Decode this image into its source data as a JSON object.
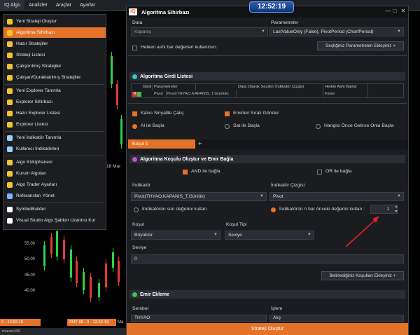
{
  "menubar": {
    "items": [
      "IQ Algo",
      "Analizler",
      "Araçlar",
      "Ayarlar"
    ],
    "clock": "12:52:19"
  },
  "dropdown": {
    "items": [
      {
        "label": "Yeni Strateji Oluştur",
        "icon": "strategy-new-icon",
        "color": "#f2c230"
      },
      {
        "label": "Algoritma Sihirbazı",
        "icon": "wizard-icon",
        "color": "#f2c230",
        "selected": true
      },
      {
        "label": "Hazır Stratejiler",
        "icon": "ready-strategies-icon",
        "color": "#f2c230"
      },
      {
        "label": "Strateji Listesi",
        "icon": "strategy-list-icon",
        "color": "#f2c230"
      },
      {
        "label": "Çalıştırılmış Stratejiler",
        "icon": "running-strategies-icon",
        "color": "#f2c230"
      },
      {
        "label": "Çalışan/Duraklatılmış Stratejiler",
        "icon": "paused-strategies-icon",
        "color": "#f2c230"
      },
      {
        "label": "Yeni Explorer Tanımla",
        "icon": "explorer-new-icon",
        "color": "#f2c230"
      },
      {
        "label": "Explorer Sihirbazı",
        "icon": "explorer-wizard-icon",
        "color": "#f2c230"
      },
      {
        "label": "Hazır Explorer Listesi",
        "icon": "explorer-ready-icon",
        "color": "#f2c230"
      },
      {
        "label": "Explorer Listesi",
        "icon": "explorer-list-icon",
        "color": "#f2c230"
      },
      {
        "label": "Yeni İndikatör Tanımla",
        "icon": "indicator-new-icon",
        "color": "#9bd0ff"
      },
      {
        "label": "Kullanıcı İndikatörleri",
        "icon": "user-indicators-icon",
        "color": "#9bd0ff"
      },
      {
        "label": "Algo Kütüphanesi",
        "icon": "library-icon",
        "color": "#f2c230"
      },
      {
        "label": "Kurum Algoları",
        "icon": "institution-algos-icon",
        "color": "#f2c230"
      },
      {
        "label": "Algo Trader Ayarları",
        "icon": "trader-settings-icon",
        "color": "#f2c230"
      },
      {
        "label": "Referansları Yönet",
        "icon": "references-icon",
        "color": "#7fb2ff"
      },
      {
        "label": "SymbolBuilder",
        "icon": "symbolbuilder-icon",
        "color": "#ffffff"
      },
      {
        "label": "Visual Studio Algo Şablon Uzantısı Kur",
        "icon": "vs-extension-icon",
        "color": "#ffffff"
      }
    ]
  },
  "chart": {
    "prices": [
      "55.00",
      "50.00",
      "45.00",
      "40.00"
    ],
    "date_label": "18 Mar",
    "bottom_left": "0 - 12:52:19",
    "bottom_mid": "2347.88 - 0 - 12:52:19",
    "bottom_mid2": "Ma",
    "footer": "maran430"
  },
  "dialog": {
    "title": "Algoritma Sihirbazı",
    "logo": "IQ",
    "data_label": "Data",
    "data_value": "Kapanış",
    "params_label": "Parametreler",
    "params_value": "LastValueOnly (False), PivotPeriod (ChartPeriod)",
    "heiken_label": "Heiken ashi bar değerleri kullanılsın.",
    "add_params_btn": "Seçtiğiniz Parametreleri Ekleyiniz",
    "input_list_title": "Algoritma Girdi Listesi",
    "table_headers": [
      "Girdi",
      "Parametreler",
      "Data Olarak Seçilen İndikatör Çizgisi",
      "Heikin Ashi Barlar"
    ],
    "table_row": [
      "Pivot",
      "Pivot(THYAO.KAPANIS_T,Günlük)",
      "",
      "False"
    ],
    "persistent_signal": "Kalıcı Sinyallle Çalış",
    "ordered_orders": "Emirleri Sıralı Gönder",
    "buy_start": "Al ile Başla",
    "sell_start": "Sat ile Başla",
    "either_start": "Hangisi Önce Gelirse Onla Başla",
    "tab_label": "Koşul 1",
    "cond_title": "Algoritma Koşulu Oluştur ve Emir Bağla",
    "and_label": "AND ile bağla",
    "or_label": "OR ile bağla",
    "indicator_label": "İndikatör",
    "indicator_value": "Pivot(THYAO.KAPANIS_T,Günlük)",
    "indicator_line_label": "İndikatör Çizgisi",
    "indicator_line_value": "Pivot",
    "use_last_value": "İndikatörün son değerini kullan",
    "use_n_bar": "İndikatörün n bar önceki değerini kullan :",
    "n_bar_value": "1",
    "condition_label": "Koşul",
    "condition_value": "Büyüktür",
    "condition_type_label": "Koşul Tipi",
    "condition_type_value": "Seviye",
    "level_label": "Seviye",
    "level_value": "0",
    "add_conditions_btn": "Belirlediğiniz Koşulları Ekleyiniz",
    "order_title": "Emir Ekleme",
    "symbol_label": "Sembol",
    "symbol_value": "THYAO",
    "action_label": "İşlem",
    "action_value": "Alış",
    "create_btn": "Strateji Oluştur"
  },
  "colors": {
    "accent": "#e4732a",
    "section_dot_teal": "#33c6c6",
    "section_dot_purple": "#c04fd6",
    "section_dot_green": "#3ec04a",
    "arrow": "#e02020"
  }
}
